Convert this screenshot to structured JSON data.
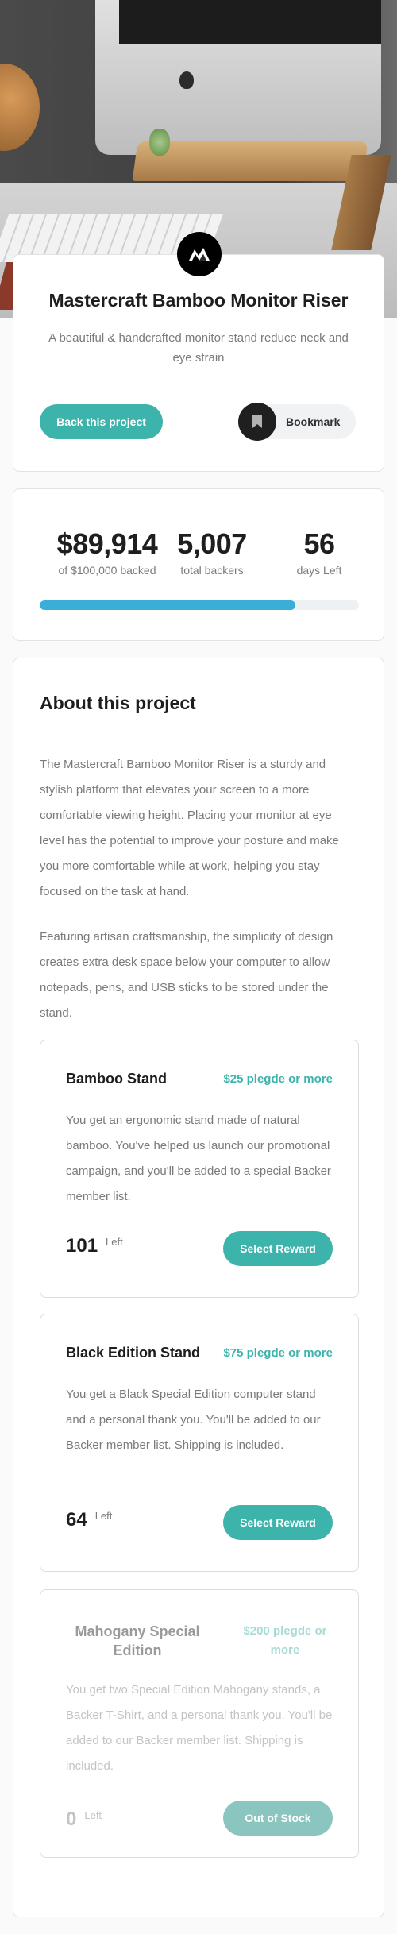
{
  "colors": {
    "accent": "#3cb3ab",
    "progress": "#3aaed6",
    "dark": "#1d1d1d"
  },
  "header": {
    "logo_icon": "mastercraft-logo-icon",
    "title": "Mastercraft Bamboo Monitor Riser",
    "subtitle": "A beautiful & handcrafted monitor stand reduce neck and eye strain",
    "back_button": "Back this project",
    "bookmark_button": "Bookmark",
    "bookmark_icon": "bookmark-icon"
  },
  "stats": {
    "backed_amount": "$89,914",
    "backed_label": "of $100,000 backed",
    "backers": "5,007",
    "backers_label": "total backers",
    "days": "56",
    "days_label": "days Left",
    "progress_fraction": 0.8
  },
  "about": {
    "heading": "About this project",
    "paragraph1": "The Mastercraft Bamboo Monitor Riser is a sturdy and stylish platform that elevates your screen to a more comfortable viewing height. Placing your monitor at eye level has the potential to improve your posture and make you more comfortable while at work, helping you stay focused on the task at hand.",
    "paragraph2": "Featuring artisan craftsmanship, the simplicity of design creates extra desk space below your computer to allow notepads, pens, and USB sticks to be stored under the stand."
  },
  "rewards": [
    {
      "name": "Bamboo Stand",
      "pledge": "$25 plegde or more",
      "description": "You get an ergonomic stand made of natural bamboo. You've helped us launch our promotional campaign, and you'll be added to a special Backer member list.",
      "count": "101",
      "left_label": "Left",
      "button": "Select Reward"
    },
    {
      "name": "Black Edition Stand",
      "pledge": "$75 plegde or more",
      "description": "You get a Black Special Edition computer stand and a personal thank you. You'll be added to our Backer member list. Shipping is included.",
      "count": "64",
      "left_label": "Left",
      "button": "Select Reward"
    },
    {
      "name": "Mahogany Special Edition",
      "pledge": "$200 plegde or more",
      "description": "You get two Special Edition Mahogany stands, a Backer T-Shirt, and a personal thank you. You'll be added to our Backer member list. Shipping is included.",
      "count": "0",
      "left_label": "Left",
      "button": "Out of Stock"
    }
  ]
}
